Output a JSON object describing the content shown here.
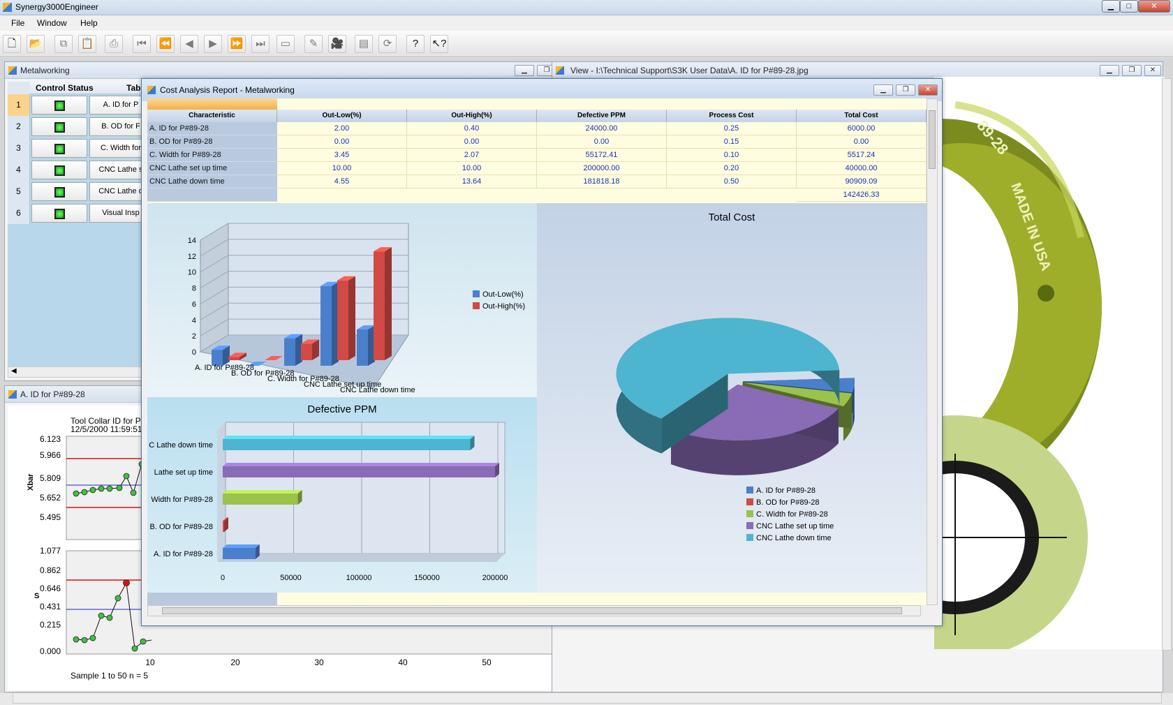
{
  "app": {
    "title": "Synergy3000Engineer"
  },
  "menu": [
    "File",
    "Window",
    "Help"
  ],
  "toolbar_icons": [
    "new-icon",
    "open-icon",
    "copy-icon",
    "paste-icon",
    "print-icon",
    "first-icon",
    "rewind-icon",
    "prev-icon",
    "next-icon",
    "fast-forward-icon",
    "last-icon",
    "save-icon",
    "edit-icon",
    "camera-icon",
    "report-icon",
    "refresh-icon",
    "help-icon",
    "context-help-icon"
  ],
  "metal": {
    "title": "Metalworking",
    "col_status": "Control Status",
    "col_table": "Table N",
    "rows": [
      {
        "n": "1",
        "name": "A. ID for P"
      },
      {
        "n": "2",
        "name": "B. OD for F"
      },
      {
        "n": "3",
        "name": "C. Width for"
      },
      {
        "n": "4",
        "name": "CNC Lathe s"
      },
      {
        "n": "5",
        "name": "CNC Lathe d"
      },
      {
        "n": "6",
        "name": "Visual Insp"
      }
    ]
  },
  "view": {
    "title": "View - I:\\Technical Support\\S3K User Data\\A. ID for P#89-28.jpg"
  },
  "photo_texts": [
    "89-28",
    "MADE IN USA"
  ],
  "spc": {
    "title": "A. ID for P#89-28",
    "chart_title": "Tool Collar ID for Part#",
    "timestamp": "12/5/2000 11:59:51",
    "xbar_label": "Xbar",
    "xbar_ticks": [
      "6.123",
      "5.966",
      "5.809",
      "5.652",
      "5.495"
    ],
    "s_label": "S",
    "s_ticks": [
      "1.077",
      "0.862",
      "0.646",
      "0.431",
      "0.215",
      "0.000"
    ],
    "x_ticks": [
      "10",
      "20",
      "30",
      "40",
      "50"
    ],
    "footer": "Sample 1 to 50  n = 5"
  },
  "report": {
    "title": "Cost Analysis Report - Metalworking",
    "headers": [
      "Characteristic",
      "Out-Low(%)",
      "Out-High(%)",
      "Defective PPM",
      "Process Cost",
      "Total Cost"
    ],
    "rows": [
      [
        "A. ID for P#89-28",
        "2.00",
        "0.40",
        "24000.00",
        "0.25",
        "6000.00"
      ],
      [
        "B. OD for P#89-28",
        "0.00",
        "0.00",
        "0.00",
        "0.15",
        "0.00"
      ],
      [
        "C. Width for P#89-28",
        "3.45",
        "2.07",
        "55172.41",
        "0.10",
        "5517.24"
      ],
      [
        "CNC Lathe set up time",
        "10.00",
        "10.00",
        "200000.00",
        "0.20",
        "40000.00"
      ],
      [
        "CNC Lathe down time",
        "4.55",
        "13.64",
        "181818.18",
        "0.50",
        "90909.09"
      ]
    ],
    "total": "142426.33"
  },
  "chart_data": [
    {
      "type": "bar",
      "categories": [
        "A. ID for P#89-28",
        "B. OD for P#89-28",
        "C. Width for P#89-28",
        "CNC Lathe set up time",
        "CNC Lathe down time"
      ],
      "series": [
        {
          "name": "Out-Low(%)",
          "values": [
            2.0,
            0.0,
            3.45,
            10.0,
            4.55
          ],
          "color": "#4a7fcc"
        },
        {
          "name": "Out-High(%)",
          "values": [
            0.4,
            0.0,
            2.07,
            10.0,
            13.64
          ],
          "color": "#d24a45"
        }
      ],
      "yticks": [
        "0",
        "2",
        "4",
        "6",
        "8",
        "10",
        "12",
        "14"
      ],
      "ylim": [
        0,
        14
      ]
    },
    {
      "type": "bar",
      "title": "Defective PPM",
      "orientation": "horizontal",
      "categories": [
        "A. ID for P#89-28",
        "B. OD for P#89-28",
        "Width for P#89-28",
        "Lathe set up time",
        "C Lathe down time"
      ],
      "values": [
        24000.0,
        0.0,
        55172.41,
        200000.0,
        181818.18
      ],
      "colors": [
        "#4a7fcc",
        "#d24a45",
        "#9bc24b",
        "#8a6bb5",
        "#4db5cf"
      ],
      "xticks": [
        "0",
        "50000",
        "100000",
        "150000",
        "200000"
      ],
      "xlim": [
        0,
        200000
      ]
    },
    {
      "type": "pie",
      "title": "Total Cost",
      "labels": [
        "A. ID for P#89-28",
        "B. OD for P#89-28",
        "C. Width for P#89-28",
        "CNC Lathe set up time",
        "CNC Lathe down time"
      ],
      "values": [
        6000.0,
        0.0,
        5517.24,
        40000.0,
        90909.09
      ],
      "colors": [
        "#4a7fcc",
        "#d24a45",
        "#9bc24b",
        "#8a6bb5",
        "#4db5cf"
      ]
    }
  ]
}
